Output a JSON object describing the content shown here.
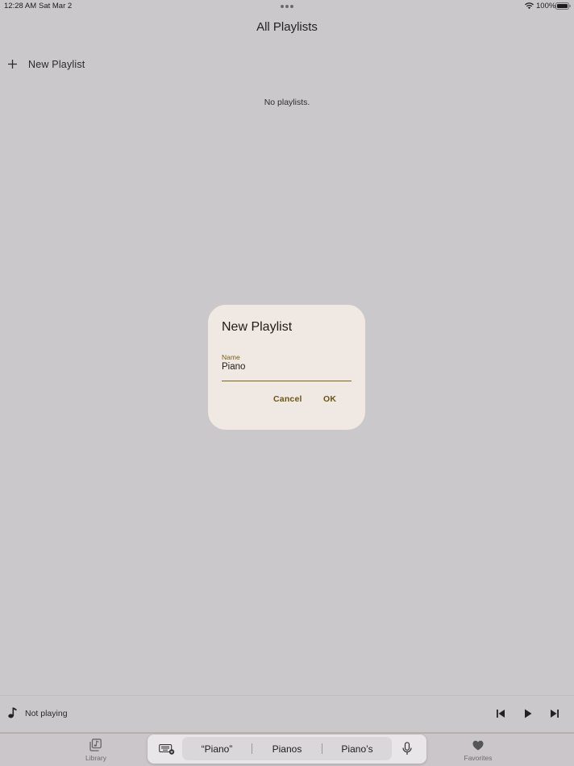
{
  "status_bar": {
    "time": "12:28 AM",
    "date": "Sat Mar 2",
    "battery": "100%"
  },
  "header": {
    "title": "All Playlists"
  },
  "new_playlist_row": {
    "label": "New Playlist",
    "icon": "plus-icon"
  },
  "empty_state": {
    "text": "No playlists."
  },
  "dialog": {
    "title": "New Playlist",
    "field_label": "Name",
    "field_value": "Piano",
    "cancel_label": "Cancel",
    "ok_label": "OK"
  },
  "now_playing": {
    "label": "Not playing"
  },
  "tabs": {
    "library": "Library",
    "favorites": "Favorites"
  },
  "keyboard_bar": {
    "suggestions": [
      "“Piano”",
      "Pianos",
      "Piano’s"
    ]
  },
  "colors": {
    "background": "#cbc8cb",
    "dialog": "#f0e8e3",
    "accent": "#7b6412"
  }
}
